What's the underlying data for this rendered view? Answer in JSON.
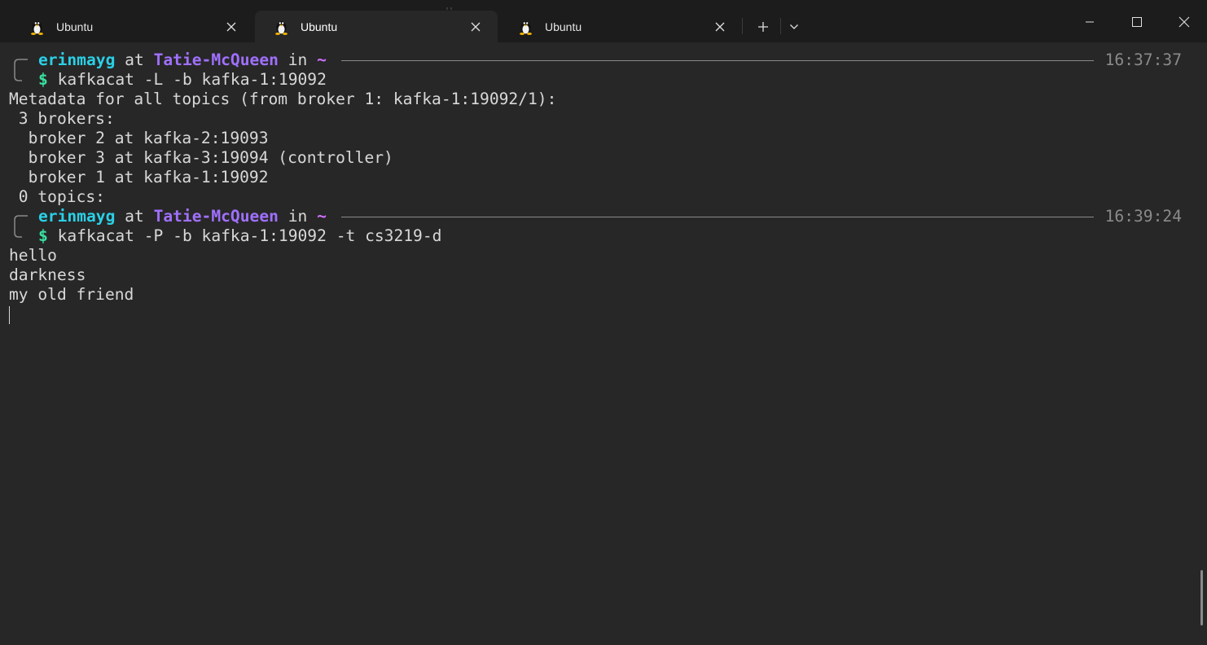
{
  "window": {
    "tabs": [
      {
        "label": "Ubuntu",
        "active": false
      },
      {
        "label": "Ubuntu",
        "active": true
      },
      {
        "label": "Ubuntu",
        "active": false
      }
    ],
    "icons": {
      "tab_icon": "tux-icon",
      "close": "close-icon",
      "new_tab": "plus-icon",
      "dropdown": "chevron-down-icon",
      "minimize": "minimize-icon",
      "maximize": "maximize-icon",
      "window_close": "close-icon"
    }
  },
  "terminal": {
    "prompts": [
      {
        "user": "erinmayg",
        "at": "at",
        "host": "Tatie-McQueen",
        "in": "in",
        "dir": "~",
        "time": "16:37:37",
        "dollar": "$",
        "command": "kafkacat -L -b kafka-1:19092"
      },
      {
        "user": "erinmayg",
        "at": "at",
        "host": "Tatie-McQueen",
        "in": "in",
        "dir": "~",
        "time": "16:39:24",
        "dollar": "$",
        "command": "kafkacat -P -b kafka-1:19092 -t cs3219-d"
      }
    ],
    "output1": [
      "Metadata for all topics (from broker 1: kafka-1:19092/1):",
      " 3 brokers:",
      "  broker 2 at kafka-2:19093",
      "  broker 3 at kafka-3:19094 (controller)",
      "  broker 1 at kafka-1:19092",
      " 0 topics:"
    ],
    "output2": [
      "hello",
      "darkness",
      "my old friend"
    ]
  },
  "colors": {
    "user": "#2ad0e6",
    "host": "#a070ff",
    "tilde": "#d070ff",
    "dollar": "#3ae0a0",
    "background": "#272727"
  }
}
